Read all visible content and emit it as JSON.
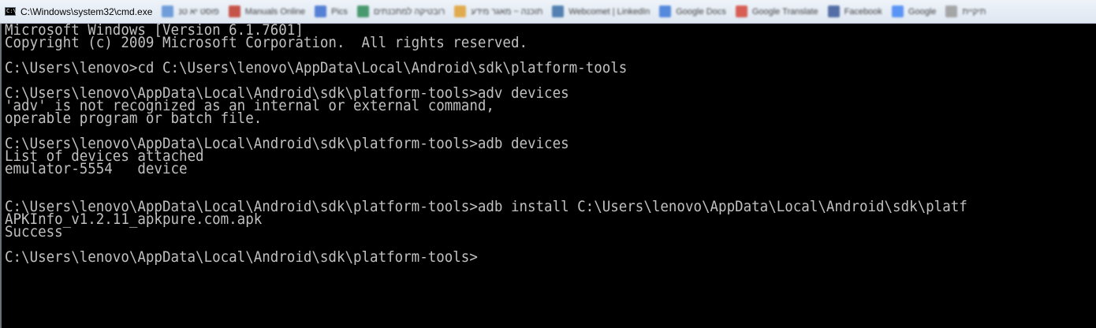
{
  "window": {
    "title": "C:\\Windows\\system32\\cmd.exe",
    "icon": "console-app-icon",
    "icon_glyph": "C:\\"
  },
  "bookmarks": [
    {
      "label": "פוסט יא טנ",
      "icon": "bookmark-favicon",
      "color": "#5b8fd6"
    },
    {
      "label": "Manuals Online",
      "icon": "bookmark-favicon",
      "color": "#c0392b"
    },
    {
      "label": "Pics",
      "icon": "bookmark-favicon",
      "color": "#3c6fcf"
    },
    {
      "label": "רובטיקה למתכנתים",
      "icon": "bookmark-favicon",
      "color": "#2e8b57"
    },
    {
      "label": "תוכנה ~ מאגר מידע",
      "icon": "bookmark-favicon",
      "color": "#e0a030"
    },
    {
      "label": "Webcomet | LinkedIn",
      "icon": "bookmark-favicon",
      "color": "#3a6ea5"
    },
    {
      "label": "Google Docs",
      "icon": "bookmark-favicon",
      "color": "#3c78d8"
    },
    {
      "label": "Google Translate",
      "icon": "bookmark-favicon",
      "color": "#d44638"
    },
    {
      "label": "Facebook",
      "icon": "bookmark-favicon",
      "color": "#3b5998"
    },
    {
      "label": "Google",
      "icon": "bookmark-favicon",
      "color": "#4285f4"
    },
    {
      "label": "תיקיית",
      "icon": "bookmark-favicon",
      "color": "#999999"
    }
  ],
  "console": {
    "text_color": "#c0c0c0",
    "background": "#000000",
    "lines": [
      "Microsoft Windows [Version 6.1.7601]",
      "Copyright (c) 2009 Microsoft Corporation.  All rights reserved.",
      "",
      "C:\\Users\\lenovo>cd C:\\Users\\lenovo\\AppData\\Local\\Android\\sdk\\platform-tools",
      "",
      "C:\\Users\\lenovo\\AppData\\Local\\Android\\sdk\\platform-tools>adv devices",
      "'adv' is not recognized as an internal or external command,",
      "operable program or batch file.",
      "",
      "C:\\Users\\lenovo\\AppData\\Local\\Android\\sdk\\platform-tools>adb devices",
      "List of devices attached",
      "emulator-5554   device",
      "",
      "",
      "C:\\Users\\lenovo\\AppData\\Local\\Android\\sdk\\platform-tools>adb install C:\\Users\\lenovo\\AppData\\Local\\Android\\sdk\\platf",
      "APKInfo_v1.2.11_apkpure.com.apk",
      "Success",
      "",
      "C:\\Users\\lenovo\\AppData\\Local\\Android\\sdk\\platform-tools>"
    ]
  }
}
